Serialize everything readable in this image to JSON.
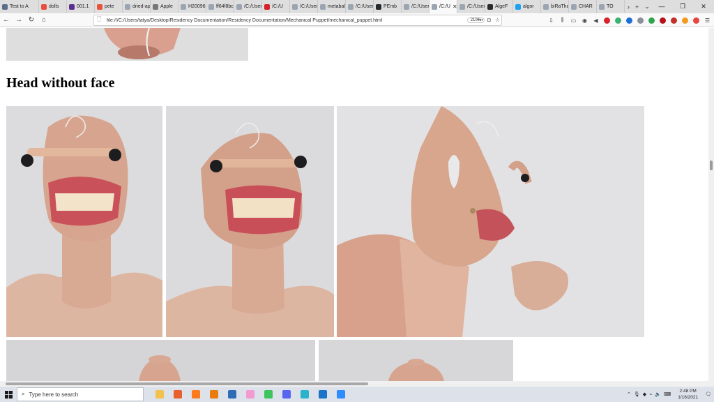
{
  "browser": {
    "tabs": [
      {
        "label": "Test to A",
        "color": "#5a6e8c"
      },
      {
        "label": "dolls",
        "color": "#e94c3d"
      },
      {
        "label": "001.1",
        "color": "#5b2d8e"
      },
      {
        "label": "pete",
        "color": "#e8533b"
      },
      {
        "label": "dried-app",
        "color": "#9aa5b1"
      },
      {
        "label": "Apple",
        "color": "#777777"
      },
      {
        "label": "H20096-1.",
        "color": "#9aa5b1"
      },
      {
        "label": "ff64f8bca",
        "color": "#9aa5b1"
      },
      {
        "label": "/C:/User",
        "color": "#9aa5b1"
      },
      {
        "label": "/C:/U",
        "color": "#d6202c"
      },
      {
        "label": "/C:/User",
        "color": "#9aa5b1"
      },
      {
        "label": "metaball",
        "color": "#9aa5b1"
      },
      {
        "label": "/C:/User",
        "color": "#9aa5b1"
      },
      {
        "label": "PEmb",
        "color": "#24292e"
      },
      {
        "label": "/C:/User",
        "color": "#9aa5b1"
      },
      {
        "label": "/C:/U",
        "color": "#9aa5b1",
        "active": true
      },
      {
        "label": "/C:/User",
        "color": "#9aa5b1"
      },
      {
        "label": "AlgeF",
        "color": "#2b2b2b"
      },
      {
        "label": "algor",
        "color": "#1da1f2"
      },
      {
        "label": "biRaThday",
        "color": "#9aa5b1"
      },
      {
        "label": "CHAR",
        "color": "#9aa5b1"
      },
      {
        "label": "TO",
        "color": "#9aa5b1"
      }
    ],
    "url": "file:///C:/Users/tatya/Desktop/Residency Documentation/Residency Documentation/Mechanical Puppet/mechanical_puppet.html",
    "zoom": "210%",
    "new_tab_glyph": "+",
    "tab_close_glyph": "✕",
    "tab_scroll_glyph": "›",
    "tab_list_glyph": "⌄",
    "window_controls": {
      "minimize": "—",
      "maximize": "❐",
      "close": "✕"
    }
  },
  "page": {
    "heading": "Head without face"
  },
  "taskbar": {
    "search_placeholder": "Type here to search",
    "apps": [
      {
        "name": "file-explorer",
        "color": "#f2c14e"
      },
      {
        "name": "firefox",
        "color": "#e8612c"
      },
      {
        "name": "sublime-text",
        "color": "#ff7a1a"
      },
      {
        "name": "blender",
        "color": "#e87d0d"
      },
      {
        "name": "app-blue",
        "color": "#2f6db5"
      },
      {
        "name": "app-pink",
        "color": "#f29bd1"
      },
      {
        "name": "app-green",
        "color": "#3ec45d"
      },
      {
        "name": "discord",
        "color": "#5865f2"
      },
      {
        "name": "app-teal",
        "color": "#2ab3c9"
      },
      {
        "name": "photos",
        "color": "#1a73c9"
      },
      {
        "name": "zoom",
        "color": "#2d8cff"
      }
    ],
    "clock_time": "2:48 PM",
    "clock_date": "1/16/2021"
  }
}
